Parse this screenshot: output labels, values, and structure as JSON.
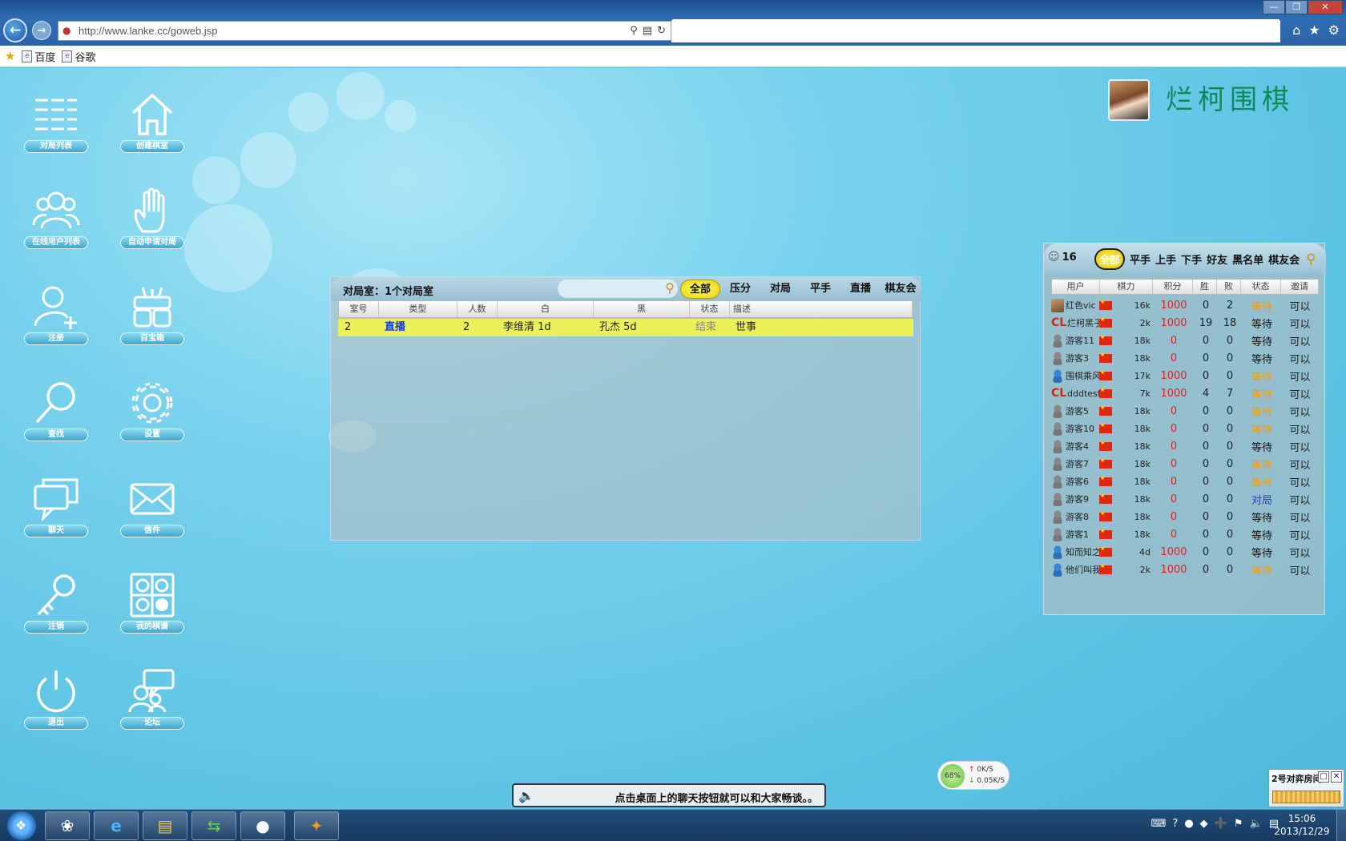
{
  "browser": {
    "url": "http://www.lanke.cc/goweb.jsp",
    "favorites": [
      {
        "label": "百度"
      },
      {
        "label": "谷歌"
      }
    ]
  },
  "desktop_icons": [
    {
      "label": "对局列表",
      "icon": "list-icon"
    },
    {
      "label": "创建棋室",
      "icon": "home-icon"
    },
    {
      "label": "在线用户列表",
      "icon": "users-icon"
    },
    {
      "label": "自动申请对局",
      "icon": "hand-icon"
    },
    {
      "label": "注册",
      "icon": "add-user-icon"
    },
    {
      "label": "百宝箱",
      "icon": "gift-box-icon"
    },
    {
      "label": "查找",
      "icon": "search-icon"
    },
    {
      "label": "设置",
      "icon": "gear-icon"
    },
    {
      "label": "聊天",
      "icon": "chat-icon"
    },
    {
      "label": "信件",
      "icon": "mail-icon"
    },
    {
      "label": "注销",
      "icon": "key-icon"
    },
    {
      "label": "我的棋谱",
      "icon": "go-board-icon"
    },
    {
      "label": "退出",
      "icon": "power-icon"
    },
    {
      "label": "论坛",
      "icon": "forum-icon"
    }
  ],
  "brand": {
    "title": "烂柯围棋"
  },
  "room_panel": {
    "title": "对局室：1个对局室",
    "tabs": [
      "全部",
      "压分",
      "对局",
      "平手",
      "直播",
      "棋友会"
    ],
    "active_tab": "全部",
    "columns": [
      "室号",
      "类型",
      "人数",
      "白",
      "黑",
      "状态",
      "描述"
    ],
    "rows": [
      {
        "no": "2",
        "type": "直播",
        "count": "2",
        "white": "李维清 1d",
        "black": "孔杰 5d",
        "state": "结束",
        "desc": "世事"
      }
    ]
  },
  "user_panel": {
    "count": "16",
    "tabs": [
      "全部",
      "平手",
      "上手",
      "下手",
      "好友",
      "黑名单",
      "棋友会"
    ],
    "active_tab": "全部",
    "columns": [
      "用户",
      "棋力",
      "积分",
      "胜",
      "败",
      "状态",
      "邀请"
    ],
    "rows": [
      {
        "name": "红色vic",
        "rank": "16k",
        "score": "1000",
        "win": "0",
        "lose": "2",
        "state": "等待",
        "invite": "可以",
        "state_color": "#e6a020",
        "avatar": "photo"
      },
      {
        "name": "烂柯黑子",
        "rank": "2k",
        "score": "1000",
        "win": "19",
        "lose": "18",
        "state": "等待",
        "invite": "可以",
        "state_color": "#111111",
        "avatar": "cl"
      },
      {
        "name": "游客11",
        "rank": "18k",
        "score": "0",
        "win": "0",
        "lose": "0",
        "state": "等待",
        "invite": "可以",
        "state_color": "#111111",
        "avatar": "guest"
      },
      {
        "name": "游客3",
        "rank": "18k",
        "score": "0",
        "win": "0",
        "lose": "0",
        "state": "等待",
        "invite": "可以",
        "state_color": "#111111",
        "avatar": "guest"
      },
      {
        "name": "围棋乘风",
        "rank": "17k",
        "score": "1000",
        "win": "0",
        "lose": "0",
        "state": "等待",
        "invite": "可以",
        "state_color": "#e6a020",
        "avatar": "member"
      },
      {
        "name": "dddtest",
        "rank": "7k",
        "score": "1000",
        "win": "4",
        "lose": "7",
        "state": "等待",
        "invite": "可以",
        "state_color": "#e6a020",
        "avatar": "cl"
      },
      {
        "name": "游客5",
        "rank": "18k",
        "score": "0",
        "win": "0",
        "lose": "0",
        "state": "等待",
        "invite": "可以",
        "state_color": "#e6a020",
        "avatar": "guest"
      },
      {
        "name": "游客10",
        "rank": "18k",
        "score": "0",
        "win": "0",
        "lose": "0",
        "state": "等待",
        "invite": "可以",
        "state_color": "#e6a020",
        "avatar": "guest"
      },
      {
        "name": "游客4",
        "rank": "18k",
        "score": "0",
        "win": "0",
        "lose": "0",
        "state": "等待",
        "invite": "可以",
        "state_color": "#111111",
        "avatar": "guest"
      },
      {
        "name": "游客7",
        "rank": "18k",
        "score": "0",
        "win": "0",
        "lose": "0",
        "state": "等待",
        "invite": "可以",
        "state_color": "#e6a020",
        "avatar": "guest"
      },
      {
        "name": "游客6",
        "rank": "18k",
        "score": "0",
        "win": "0",
        "lose": "0",
        "state": "等待",
        "invite": "可以",
        "state_color": "#e6a020",
        "avatar": "guest"
      },
      {
        "name": "游客9",
        "rank": "18k",
        "score": "0",
        "win": "0",
        "lose": "0",
        "state": "对局",
        "invite": "可以",
        "state_color": "#1a3ad6",
        "avatar": "guest"
      },
      {
        "name": "游客8",
        "rank": "18k",
        "score": "0",
        "win": "0",
        "lose": "0",
        "state": "等待",
        "invite": "可以",
        "state_color": "#111111",
        "avatar": "guest"
      },
      {
        "name": "游客1",
        "rank": "18k",
        "score": "0",
        "win": "0",
        "lose": "0",
        "state": "等待",
        "invite": "可以",
        "state_color": "#111111",
        "avatar": "guest"
      },
      {
        "name": "知而知之",
        "rank": "4d",
        "score": "1000",
        "win": "0",
        "lose": "0",
        "state": "等待",
        "invite": "可以",
        "state_color": "#111111",
        "avatar": "member"
      },
      {
        "name": "他们叫我",
        "rank": "2k",
        "score": "1000",
        "win": "0",
        "lose": "0",
        "state": "等待",
        "invite": "可以",
        "state_color": "#e6a020",
        "avatar": "member"
      }
    ]
  },
  "speed_widget": {
    "percent": "68%",
    "up": "0K/S",
    "down": "0.05K/S"
  },
  "chat_bar": {
    "message": "点击桌面上的聊天按钮就可以和大家畅谈。。"
  },
  "mini_room": {
    "title": "2号对弈房间"
  },
  "taskbar": {
    "time": "15:06",
    "date": "2013/12/29"
  }
}
